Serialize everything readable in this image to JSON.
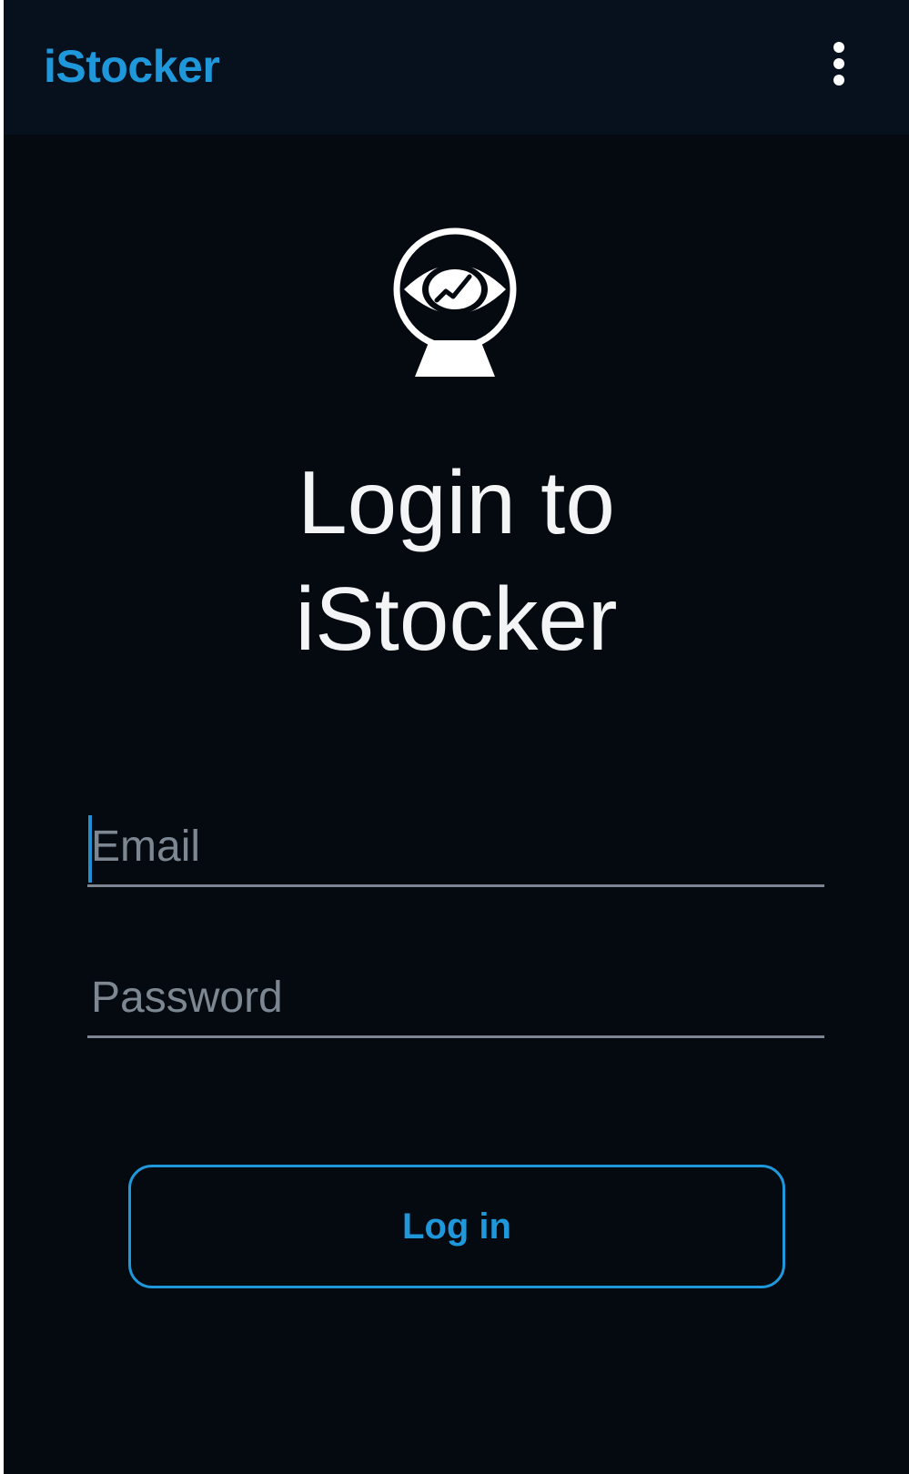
{
  "app_bar": {
    "title": "iStocker",
    "menu_icon": "more-vert-icon"
  },
  "logo": {
    "icon": "eye-chart-icon"
  },
  "heading": {
    "line1": "Login to",
    "line2": "iStocker"
  },
  "form": {
    "email": {
      "placeholder": "Email",
      "value": ""
    },
    "password": {
      "placeholder": "Password",
      "value": ""
    },
    "login_label": "Log in"
  },
  "colors": {
    "accent": "#1f98db",
    "background": "#050a11",
    "app_bar": "#06111d",
    "text": "#f2f4f6",
    "placeholder": "#7d8792"
  }
}
